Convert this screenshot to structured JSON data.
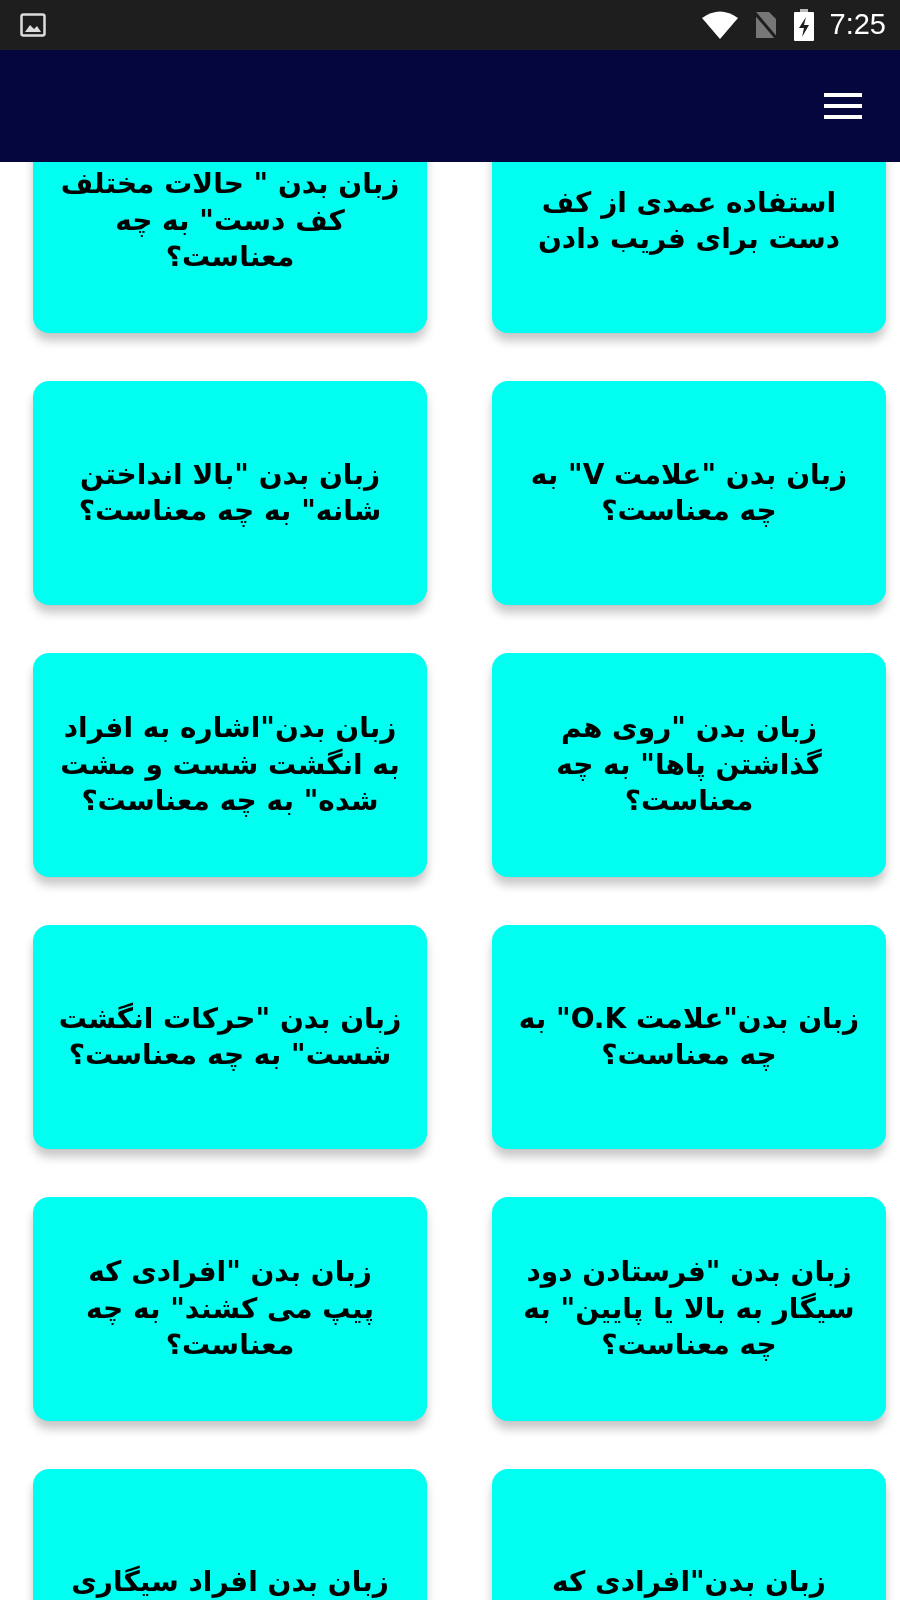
{
  "status_bar": {
    "time": "7:25"
  },
  "rows": [
    {
      "cards": [
        {
          "lines": [
            "استفاده عمدی از کف",
            "دست برای فریب دادن"
          ]
        },
        {
          "lines": [
            "زبان بدن \" حالات مختلف",
            "کف دست\" به چه",
            "معناست؟"
          ]
        }
      ]
    },
    {
      "cards": [
        {
          "lines": [
            "زبان بدن \"علامت V\" به",
            "چه معناست؟"
          ]
        },
        {
          "lines": [
            "زبان بدن \"بالا انداختن",
            "شانه\" به چه معناست؟"
          ]
        }
      ]
    },
    {
      "cards": [
        {
          "lines": [
            "زبان بدن \"روی هم",
            "گذاشتن پاها\" به چه",
            "معناست؟"
          ]
        },
        {
          "lines": [
            "زبان بدن\"اشاره به افراد",
            "به انگشت شست و مشت",
            "شده\" به چه معناست؟"
          ]
        }
      ]
    },
    {
      "cards": [
        {
          "lines": [
            "زبان بدن\"علامت O.K\" به",
            "چه معناست؟"
          ]
        },
        {
          "lines": [
            "زبان بدن \"حرکات انگشت",
            "شست\" به چه معناست؟"
          ]
        }
      ]
    },
    {
      "cards": [
        {
          "lines": [
            "زبان بدن \"فرستادن دود",
            "سیگار به بالا یا پایین\" به",
            "چه معناست؟"
          ]
        },
        {
          "lines": [
            "زبان بدن \"افرادی که",
            "پیپ می کشند\" به چه",
            "معناست؟"
          ]
        }
      ]
    },
    {
      "cards": [
        {
          "lines": [
            "زبان بدن\"افرادی که"
          ]
        },
        {
          "lines": [
            "زبان بدن افراد سیگاری"
          ]
        }
      ]
    }
  ]
}
